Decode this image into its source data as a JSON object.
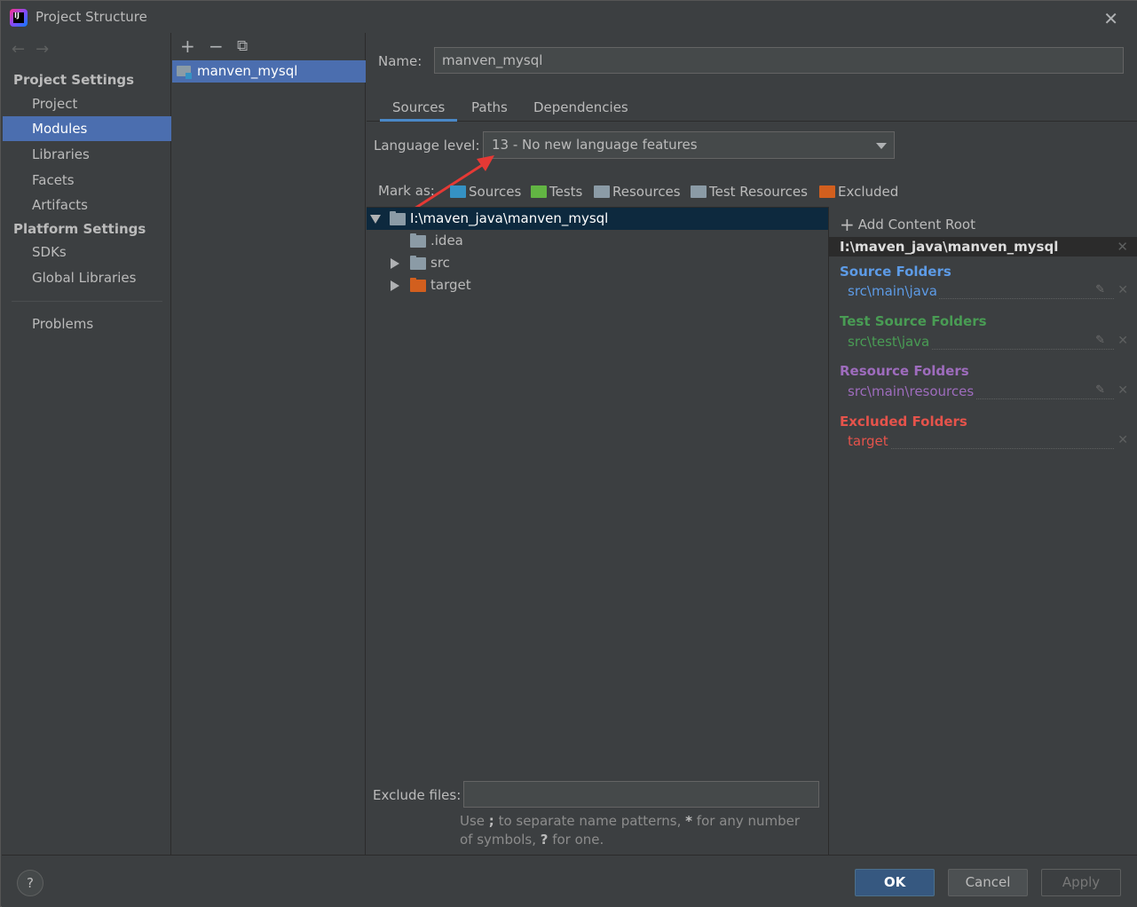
{
  "window": {
    "title": "Project Structure",
    "app_icon_text": "IJ"
  },
  "sidebar": {
    "project_settings_header": "Project Settings",
    "project_items": [
      {
        "label": "Project"
      },
      {
        "label": "Modules",
        "selected": true
      },
      {
        "label": "Libraries"
      },
      {
        "label": "Facets"
      },
      {
        "label": "Artifacts"
      }
    ],
    "platform_settings_header": "Platform Settings",
    "platform_items": [
      {
        "label": "SDKs"
      },
      {
        "label": "Global Libraries"
      }
    ],
    "problems_label": "Problems"
  },
  "modules": {
    "toolbar": {
      "add": "+",
      "remove": "−",
      "copy": "⧉"
    },
    "items": [
      {
        "label": "manven_mysql",
        "selected": true
      }
    ]
  },
  "main": {
    "name_label": "Name:",
    "name_value": "manven_mysql",
    "tabs": [
      {
        "label": "Sources",
        "active": true
      },
      {
        "label": "Paths"
      },
      {
        "label": "Dependencies"
      }
    ],
    "language_level_label": "Language level:",
    "language_level_value": "13 - No new language features",
    "mark_as_label": "Mark as:",
    "mark_as": [
      {
        "label": "Sources",
        "color": "#3592c4"
      },
      {
        "label": "Tests",
        "color": "#62b543"
      },
      {
        "label": "Resources",
        "color": "#8b9ba6"
      },
      {
        "label": "Test Resources",
        "color": "#8b9ba6"
      },
      {
        "label": "Excluded",
        "color": "#d25f1e"
      }
    ],
    "tree": [
      {
        "label": "I:\\maven_java\\manven_mysql",
        "expanded": true,
        "folder": "gray"
      },
      {
        "label": ".idea",
        "folder": "gray"
      },
      {
        "label": "src",
        "expanded": false,
        "folder": "gray"
      },
      {
        "label": "target",
        "expanded": false,
        "folder": "orange"
      }
    ],
    "content_root": {
      "add_label": "Add Content Root",
      "path": "I:\\maven_java\\manven_mysql",
      "source_folders": {
        "title": "Source Folders",
        "entry": "src\\main\\java",
        "color": "#5d9be6"
      },
      "test_source_folders": {
        "title": "Test Source Folders",
        "entry": "src\\test\\java",
        "color": "#499c54"
      },
      "resource_folders": {
        "title": "Resource Folders",
        "entry": "src\\main\\resources",
        "color": "#9e6cbd"
      },
      "excluded_folders": {
        "title": "Excluded Folders",
        "entry": "target",
        "color": "#e5534b"
      }
    },
    "exclude_files_label": "Exclude files:",
    "exclude_files_value": "",
    "hint_part1": "Use ",
    "hint_sep": ";",
    "hint_part2": " to separate name patterns, ",
    "hint_star": "*",
    "hint_part3": " for any number of symbols, ",
    "hint_q": "?",
    "hint_part4": " for one."
  },
  "buttons": {
    "help": "?",
    "ok": "OK",
    "cancel": "Cancel",
    "apply": "Apply"
  }
}
